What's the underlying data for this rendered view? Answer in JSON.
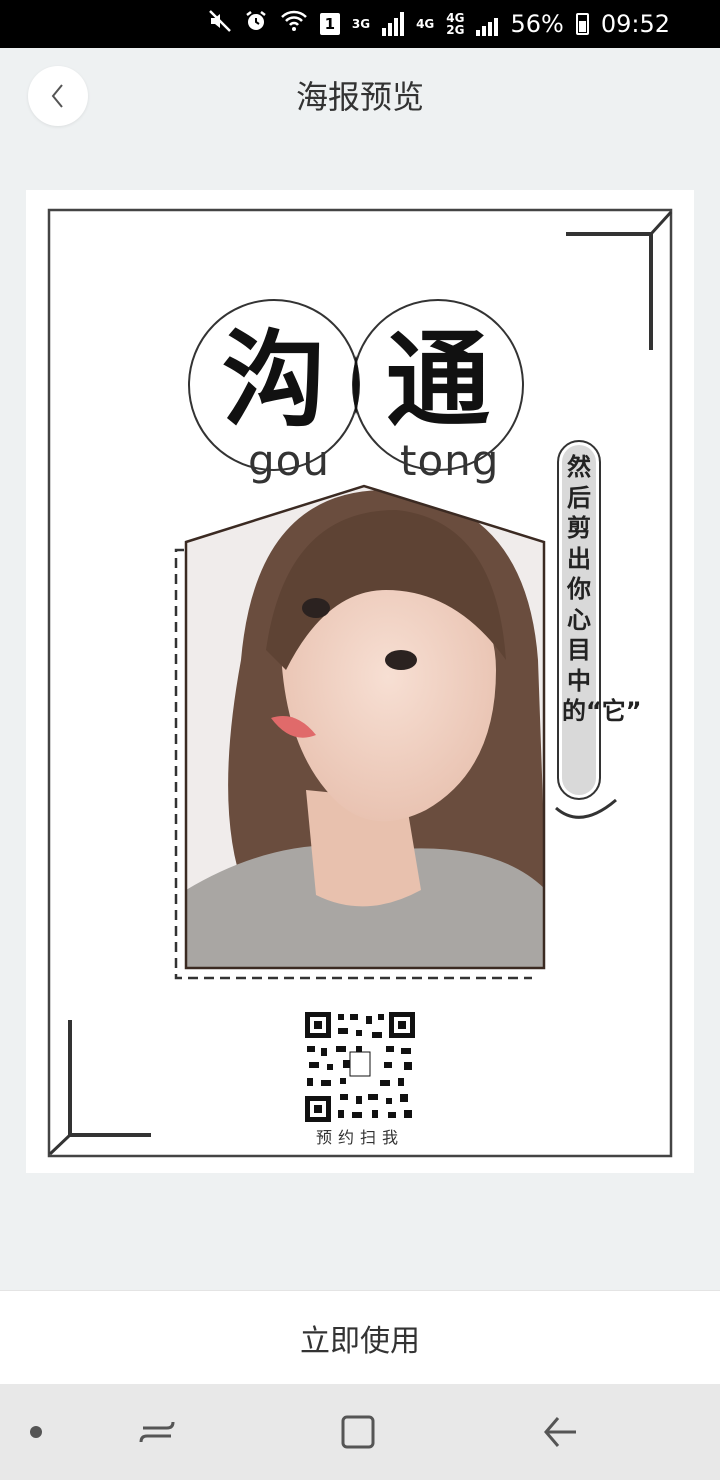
{
  "status_bar": {
    "network_1": "3G",
    "network_2": "4G",
    "network_3a": "4G",
    "network_3b": "2G",
    "sim": "1",
    "battery": "56%",
    "time": "09:52"
  },
  "header": {
    "title": "海报预览"
  },
  "poster": {
    "pinyin_left": "gou",
    "pinyin_right": "tong",
    "char_left": "沟",
    "char_right": "通",
    "side_text": "然后剪出你心目中的“它”",
    "qr_caption": "预约扫我"
  },
  "action": {
    "use_label": "立即使用"
  }
}
